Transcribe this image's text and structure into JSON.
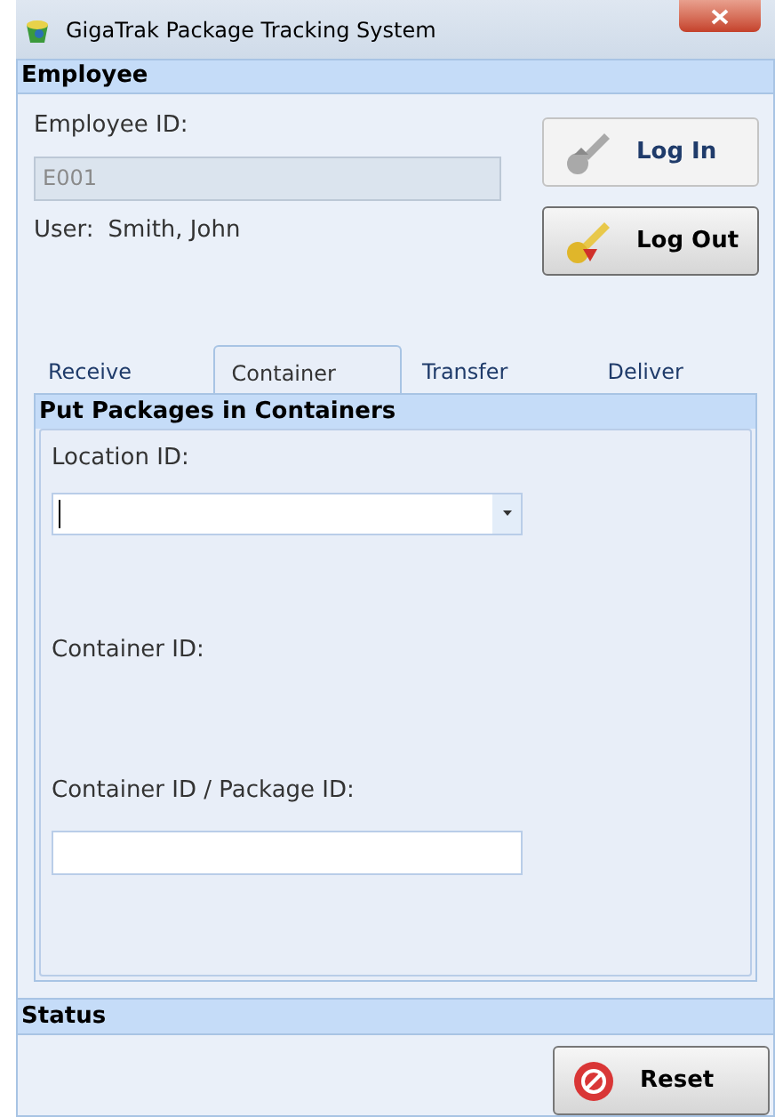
{
  "window": {
    "title": "GigaTrak Package Tracking System"
  },
  "employee": {
    "header": "Employee",
    "id_label": "Employee ID:",
    "id_field": {
      "value": "E001",
      "disabled": true
    },
    "user_label": "User:",
    "user_name": "Smith, John",
    "buttons": [
      {
        "kind": "login",
        "label": "Log In",
        "disabled": true
      },
      {
        "kind": "logout",
        "label": "Log Out",
        "disabled": false
      }
    ]
  },
  "tabs": [
    {
      "label": "Receive",
      "selected": false
    },
    {
      "label": "Container",
      "selected": true
    },
    {
      "label": "Transfer",
      "selected": false
    },
    {
      "label": "Deliver",
      "selected": false
    }
  ],
  "panel": {
    "header": "Put Packages in Containers",
    "location_label": "Location ID:",
    "container_label": "Container ID:",
    "package_label": "Container ID / Package ID:"
  },
  "status": {
    "header": "Status",
    "reset_button": "Reset"
  }
}
